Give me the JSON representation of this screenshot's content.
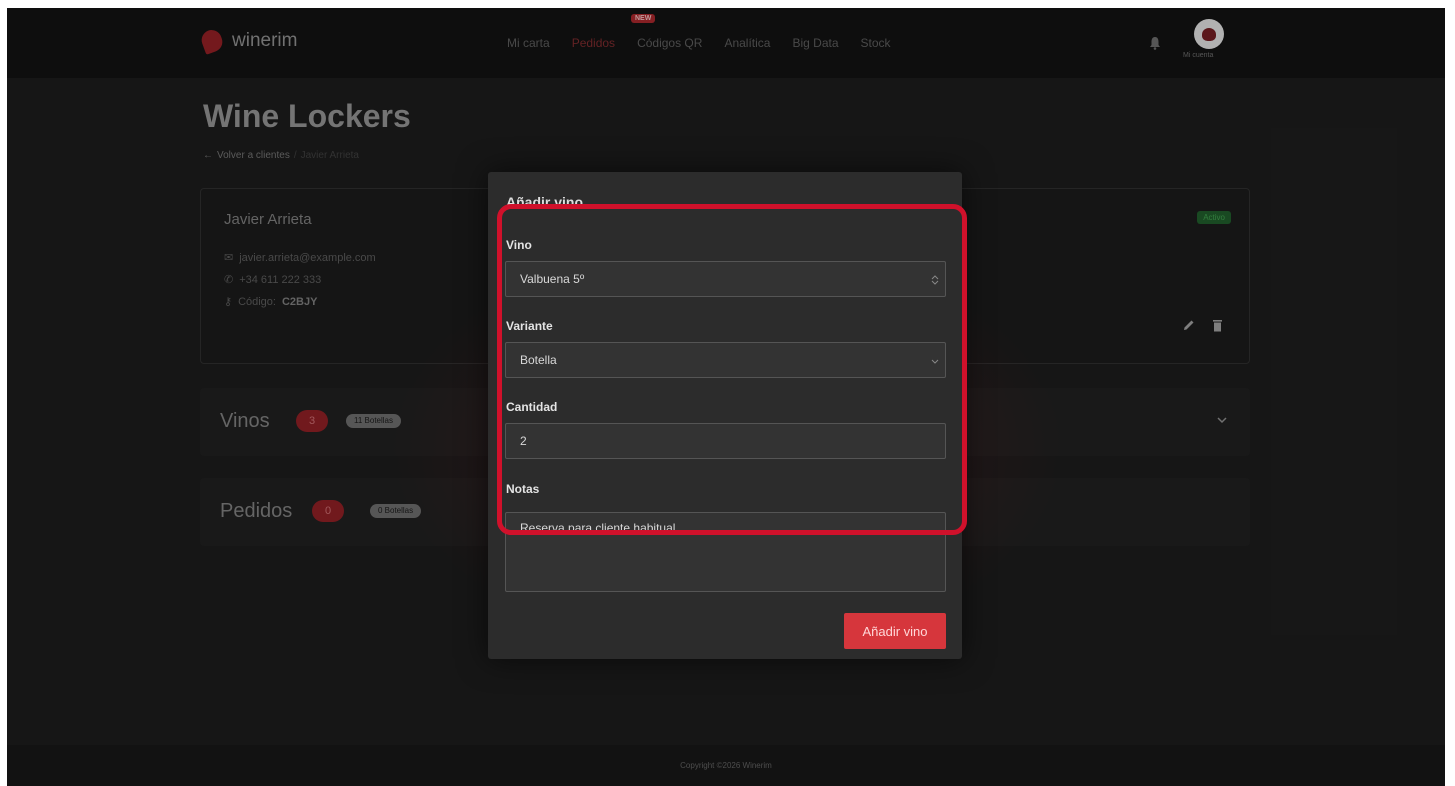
{
  "navbar": {
    "brand": "winerim",
    "links": [
      "Mi carta",
      "Pedidos",
      "Códigos QR",
      "Analítica",
      "Big Data",
      "Stock"
    ],
    "active_link_index": 1,
    "new_badge": "NEW",
    "account_label": "Mi cuenta"
  },
  "page": {
    "title": "Wine Lockers",
    "breadcrumb": {
      "back": "Volver a clientes",
      "separator": "/",
      "current": "Javier Arrieta"
    }
  },
  "client": {
    "name": "Javier Arrieta",
    "email": "javier.arrieta@example.com",
    "phone": "+34 611 222 333",
    "code_label": "Código:",
    "code": "C2BJY",
    "status": "Activo"
  },
  "sections": {
    "vinos": {
      "title": "Vinos",
      "count": "3",
      "pill": "11 Botellas"
    },
    "pedidos": {
      "title": "Pedidos",
      "count": "0",
      "pill": "0 Botellas"
    }
  },
  "modal": {
    "title": "Añadir vino",
    "wine_label": "Vino",
    "wine_value": "Valbuena 5º",
    "variant_label": "Variante",
    "variant_value": "Botella",
    "quantity_label": "Cantidad",
    "quantity_value": "2",
    "notes_label": "Notas",
    "notes_value": "Reserva para cliente habitual",
    "submit_label": "Añadir vino"
  },
  "footer": {
    "copyright": "Copyright ©2026 Winerim"
  },
  "colors": {
    "accent": "#d6363c",
    "highlight": "#d0112b",
    "brand": "#8e1f24"
  }
}
